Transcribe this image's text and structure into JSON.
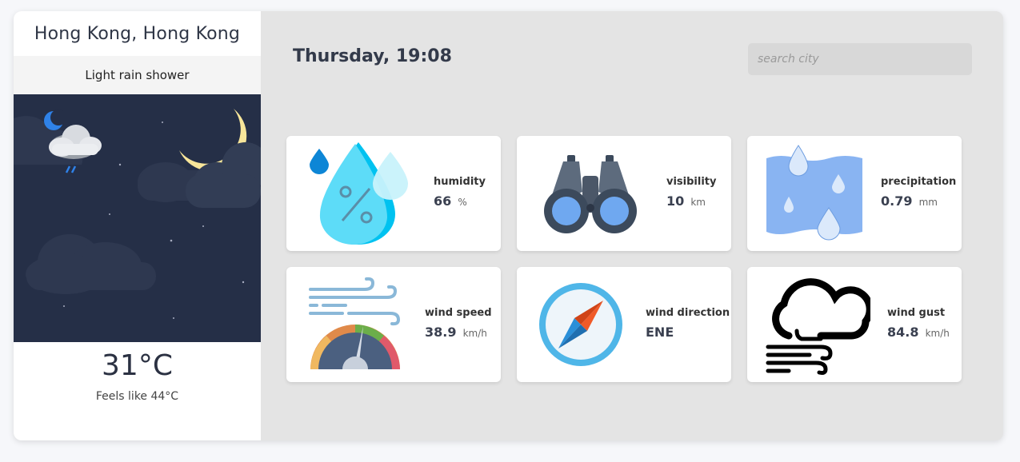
{
  "location": {
    "city": "Hong Kong, Hong Kong"
  },
  "current": {
    "condition": "Light rain shower",
    "temperature": "31°C",
    "feels_like": "Feels like 44°C"
  },
  "header": {
    "datetime": "Thursday, 19:08",
    "search_placeholder": "search city"
  },
  "metrics": {
    "humidity": {
      "label": "humidity",
      "value": "66",
      "unit": "%",
      "icon": "humidity-icon"
    },
    "visibility": {
      "label": "visibility",
      "value": "10",
      "unit": "km",
      "icon": "binoculars-icon"
    },
    "precipitation": {
      "label": "precipitation",
      "value": "0.79",
      "unit": "mm",
      "icon": "rain-drops-icon"
    },
    "wind_speed": {
      "label": "wind speed",
      "value": "38.9",
      "unit": "km/h",
      "icon": "wind-gauge-icon"
    },
    "wind_direction": {
      "label": "wind direction",
      "value": "ENE",
      "unit": "",
      "icon": "compass-icon"
    },
    "wind_gust": {
      "label": "wind gust",
      "value": "84.8",
      "unit": "km/h",
      "icon": "cloud-wind-icon"
    }
  },
  "colors": {
    "night_sky": "#252f47",
    "card_bg": "#ffffff",
    "main_bg": "#e4e4e4"
  }
}
